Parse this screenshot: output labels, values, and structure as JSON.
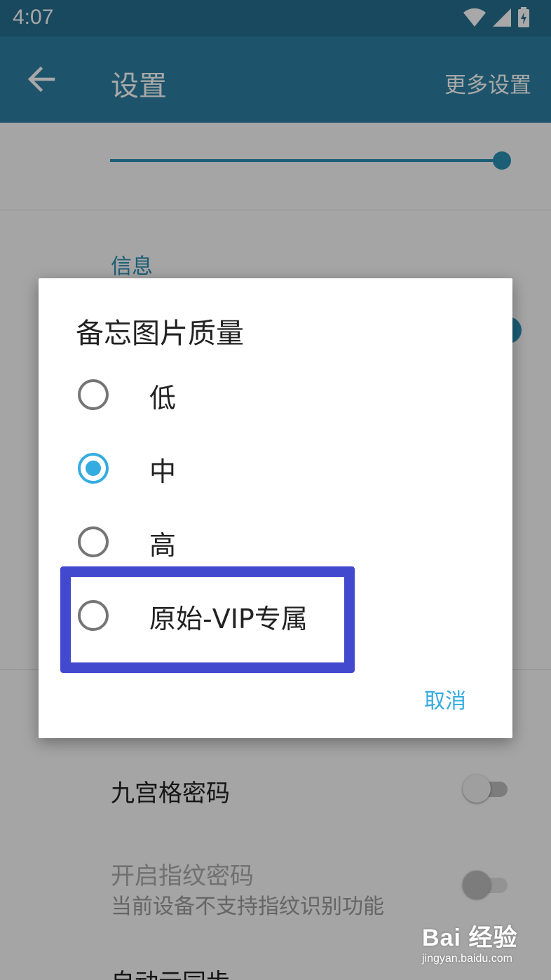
{
  "statusbar": {
    "time": "4:07"
  },
  "toolbar": {
    "title": "设置",
    "more": "更多设置"
  },
  "settings": {
    "section_label": "信息",
    "rows": [
      {
        "label": "九宫格密码",
        "enabled": true,
        "toggle_on": false
      },
      {
        "label": "开启指纹密码",
        "sublabel": "当前设备不支持指纹识别功能",
        "enabled": false,
        "toggle_on": false
      },
      {
        "label": "自动云同步",
        "partially_visible": true
      }
    ]
  },
  "dialog": {
    "title": "备忘图片质量",
    "options": [
      {
        "label": "低",
        "checked": false
      },
      {
        "label": "中",
        "checked": true
      },
      {
        "label": "高",
        "checked": false
      },
      {
        "label": "原始-VIP专属",
        "checked": false
      }
    ],
    "cancel": "取消"
  },
  "watermark": {
    "main": "Bai 经验",
    "sub": "jingyan.baidu.com"
  },
  "colors": {
    "primary": "#2c80a3",
    "accent": "#34ace0",
    "highlight": "#4349cf"
  }
}
